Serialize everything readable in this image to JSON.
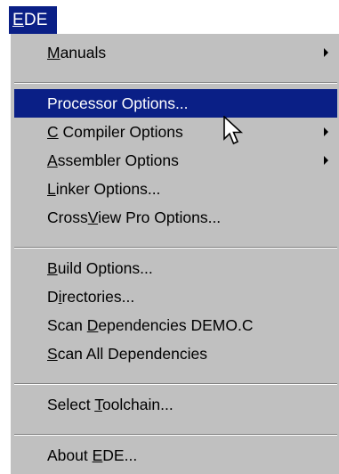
{
  "menubar": {
    "title_prefix": "",
    "title_underlined": "E",
    "title_rest": "DE"
  },
  "menu": {
    "items": [
      {
        "key": "manuals",
        "before": "",
        "underlined": "M",
        "after": "anuals",
        "submenu": true,
        "icon": "chevron-right-icon"
      },
      {
        "key": "processor-options",
        "before": "",
        "underlined": "",
        "after": "Processor Options...",
        "highlighted": true
      },
      {
        "key": "c-compiler-options",
        "before": "",
        "underlined": "C",
        "after": " Compiler Options",
        "submenu": true,
        "icon": "chevron-right-icon"
      },
      {
        "key": "assembler-options",
        "before": "",
        "underlined": "A",
        "after": "ssembler Options",
        "submenu": true,
        "icon": "chevron-right-icon"
      },
      {
        "key": "linker-options",
        "before": "",
        "underlined": "L",
        "after": "inker Options..."
      },
      {
        "key": "crossview-pro-options",
        "before": "Cross",
        "underlined": "V",
        "after": "iew Pro Options..."
      },
      {
        "key": "build-options",
        "before": "",
        "underlined": "B",
        "after": "uild Options..."
      },
      {
        "key": "directories",
        "before": "D",
        "underlined": "i",
        "after": "rectories..."
      },
      {
        "key": "scan-dependencies",
        "before": "Scan ",
        "underlined": "D",
        "after": "ependencies DEMO.C"
      },
      {
        "key": "scan-all-dependencies",
        "before": "",
        "underlined": "S",
        "after": "can All Dependencies"
      },
      {
        "key": "select-toolchain",
        "before": "Select ",
        "underlined": "T",
        "after": "oolchain..."
      },
      {
        "key": "about-ede",
        "before": "About ",
        "underlined": "E",
        "after": "DE..."
      }
    ]
  },
  "colors": {
    "highlight": "#0a1f86",
    "menu_background": "#c0c0c0"
  },
  "cursor": {
    "icon": "mouse-pointer-icon"
  }
}
